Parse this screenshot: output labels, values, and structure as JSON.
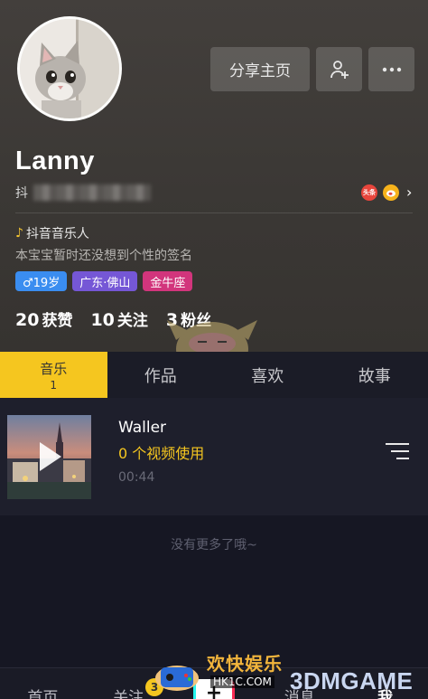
{
  "header": {
    "share_label": "分享主页",
    "username": "Lanny",
    "douyin_id_prefix": "抖",
    "toutiao_badge": "头条",
    "musician_label": "抖音音乐人",
    "bio": "本宝宝暂时还没想到个性的签名",
    "tags": {
      "gender_age": "♂19岁",
      "location": "广东·佛山",
      "zodiac": "金牛座"
    },
    "stats": [
      {
        "num": "20",
        "label": "获赞"
      },
      {
        "num": "10",
        "label": "关注"
      },
      {
        "num": "3",
        "label": "粉丝"
      }
    ]
  },
  "tabs": [
    {
      "label": "音乐",
      "count": "1",
      "active": true
    },
    {
      "label": "作品"
    },
    {
      "label": "喜欢"
    },
    {
      "label": "故事"
    }
  ],
  "music": {
    "title": "Waller",
    "usage": "0 个视频使用",
    "duration": "00:44"
  },
  "no_more_text": "没有更多了哦~",
  "bottom_nav": {
    "home": "首页",
    "follow": "关注",
    "follow_badge": "3",
    "plus": "+",
    "messages": "消息",
    "me": "我"
  },
  "watermark": {
    "title": "欢快娱乐",
    "site": "HK1C.COM",
    "brand": "3DMGAME"
  },
  "colors": {
    "accent": "#f5c61f",
    "background": "#161723",
    "header_bg": "#3b3835",
    "tag_gender": "#3a8df0",
    "tag_location": "#7557d6",
    "tag_zodiac": "#d2357c"
  },
  "icons": [
    "add-friend-icon",
    "more-icon",
    "music-note-icon",
    "toutiao-icon",
    "weibo-icon",
    "chevron-right-icon",
    "play-icon",
    "playlist-icon"
  ]
}
